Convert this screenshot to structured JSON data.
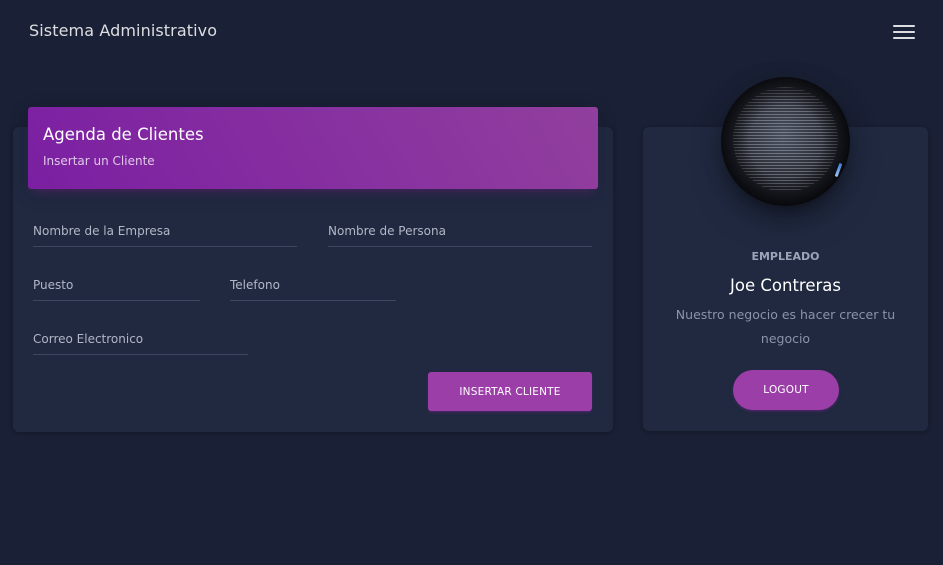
{
  "navbar": {
    "brand": "Sistema Administrativo",
    "menu_icon": "hamburger-menu-icon"
  },
  "form": {
    "title": "Agenda de Clientes",
    "subtitle": "Insertar un Cliente",
    "fields": {
      "empresa": "Nombre de la Empresa",
      "persona": "Nombre de Persona",
      "puesto": "Puesto",
      "telefono": "Telefono",
      "correo": "Correo Electronico"
    },
    "submit_label": "INSERTAR CLIENTE"
  },
  "profile": {
    "avatar_icon": "profile-photo",
    "role": "EMPLEADO",
    "name": "Joe Contreras",
    "description": "Nuestro negocio es hacer crecer tu negocio",
    "logout_label": "LOGOUT"
  },
  "colors": {
    "background": "#1a2035",
    "card": "#202940",
    "accent": "#9c27b0",
    "button": "#9c3ea8"
  }
}
